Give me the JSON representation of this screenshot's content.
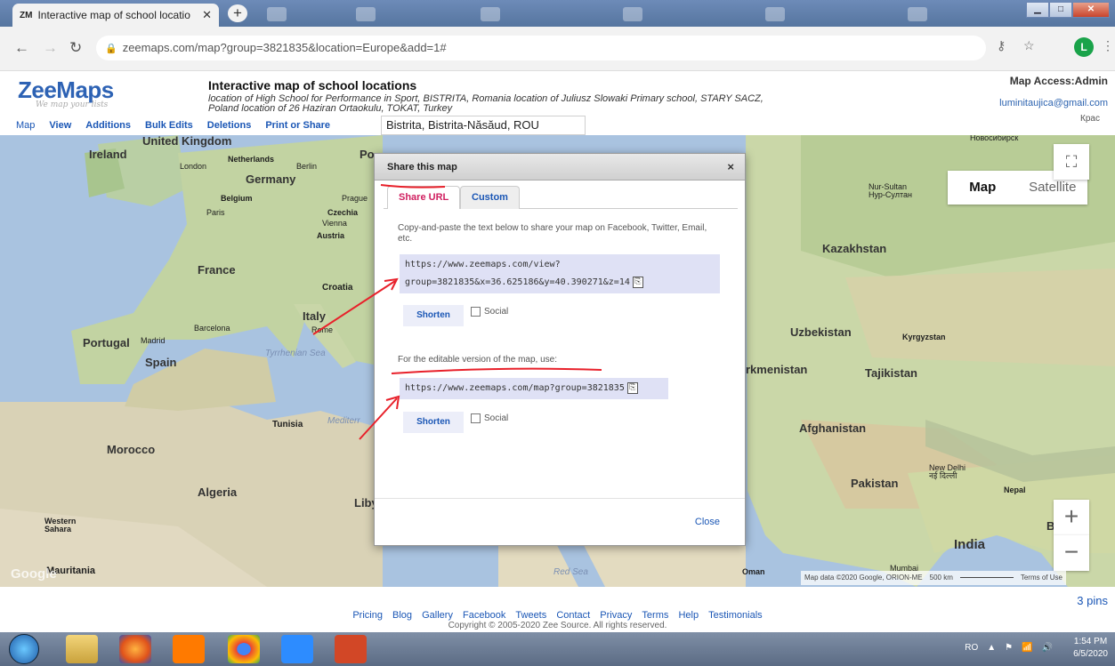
{
  "browser": {
    "tab_title": "Interactive map of school locatio",
    "tab_favicon": "ZM",
    "url": "zeemaps.com/map?group=3821835&location=Europe&add=1#",
    "profile_initial": "L"
  },
  "header": {
    "logo": "ZeeMaps",
    "tagline": "We map your lists",
    "title": "Interactive map of school locations",
    "description": "location of High School for Performance in Sport, BISTRITA, Romania location of Juliusz Slowaki Primary school, STARY SACZ, Poland location of 26 Haziran Ortaokulu, TOKAT, Turkey",
    "access": "Map Access:Admin",
    "email": "luminitaujica@gmail.com"
  },
  "menu": {
    "items": [
      "Map",
      "View",
      "Additions",
      "Bulk Edits",
      "Deletions",
      "Print or Share"
    ],
    "location": "Bistrita, Bistrita-Năsăud, ROU"
  },
  "map": {
    "type_buttons": [
      "Map",
      "Satellite"
    ],
    "zoom_in": "+",
    "zoom_out": "−",
    "attribution": "Map data ©2020 Google, ORION-ME",
    "scale": "500 km",
    "terms": "Terms of Use",
    "google": "Google",
    "corner_label": "Крас",
    "labels": {
      "uk": "United Kingdom",
      "ireland": "Ireland",
      "london": "London",
      "netherlands": "Netherlands",
      "berlin": "Berlin",
      "germany": "Germany",
      "belgium": "Belgium",
      "prague": "Prague",
      "paris": "Paris",
      "czechia": "Czechia",
      "vienna": "Vienna",
      "austria": "Austria",
      "france": "France",
      "croatia": "Croatia",
      "italy": "Italy",
      "rome": "Rome",
      "barcelona": "Barcelona",
      "portugal": "Portugal",
      "madrid": "Madrid",
      "spain": "Spain",
      "tyrrhenian": "Tyrrhenian Sea",
      "mediterranean": "Mediterr",
      "tunisia": "Tunisia",
      "morocco": "Morocco",
      "algeria": "Algeria",
      "libya": "Liby",
      "western_sahara": "Western Sahara",
      "mauritania": "Mauritania",
      "po": "Po",
      "novosibirsk": "Novosibirsk Новосибирск",
      "nursultan": "Nur-Sultan Нур-Султан",
      "kazakhstan": "Kazakhstan",
      "uzbekistan": "Uzbekistan",
      "kyrgyzstan": "Kyrgyzstan",
      "turkmenistan": "rkmenistan",
      "tajikistan": "Tajikistan",
      "afghanistan": "Afghanistan",
      "pakistan": "Pakistan",
      "newdelhi": "New Delhi नई दिल्ली",
      "nepal": "Nepal",
      "india": "India",
      "mumbai": "Mumbai",
      "oman": "Oman",
      "redsea": "Red Sea",
      "b": "B"
    }
  },
  "modal": {
    "title": "Share this map",
    "close_x": "×",
    "tabs": [
      "Share URL",
      "Custom"
    ],
    "instructions": "Copy-and-paste the text below to share your map on Facebook, Twitter, Email, etc.",
    "share_url_line1": "https://www.zeemaps.com/view?",
    "share_url_line2": "group=3821835&x=36.625186&y=40.390271&z=14",
    "shorten": "Shorten",
    "social": "Social",
    "editable_label": "For the editable version of the map, use:",
    "edit_url": "https://www.zeemaps.com/map?group=3821835",
    "close": "Close"
  },
  "pins": "3 pins",
  "footer": {
    "links": [
      "Pricing",
      "Blog",
      "Gallery",
      "Facebook",
      "Tweets",
      "Contact",
      "Privacy",
      "Terms",
      "Help",
      "Testimonials"
    ],
    "copyright": "Copyright © 2005-2020 Zee Source. All rights reserved."
  },
  "taskbar": {
    "lang": "RO",
    "time": "1:54 PM",
    "date": "6/5/2020"
  },
  "colors": {
    "annotation": "#e8202a",
    "link": "#1a56b5",
    "share_tab": "#d02060",
    "url_box": "#dfe1f5"
  }
}
